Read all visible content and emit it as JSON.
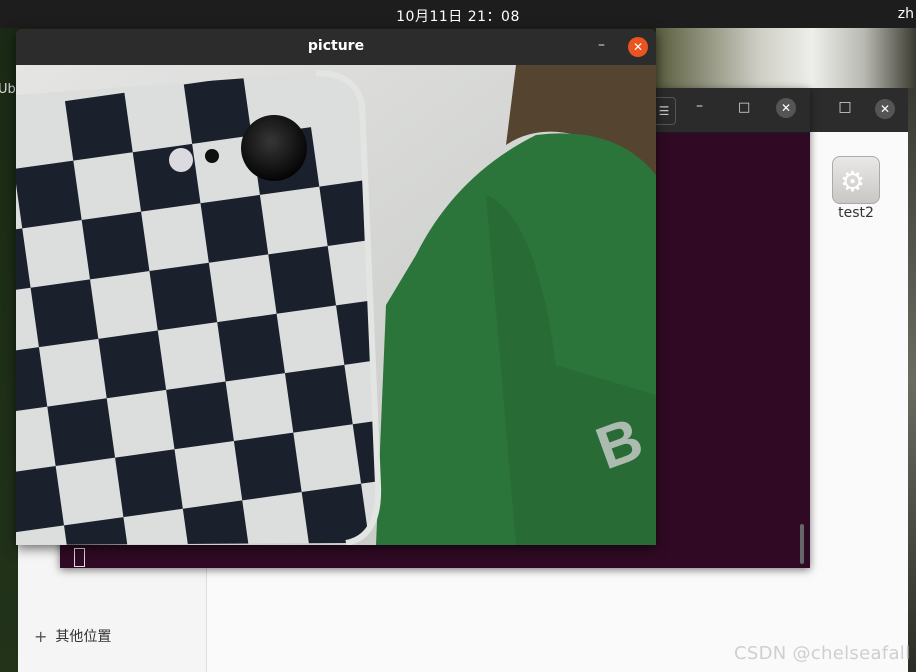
{
  "topbar": {
    "clock": "10月11日  21：08",
    "language": "zh"
  },
  "background": {
    "left_label": "Ub"
  },
  "file_manager": {
    "sidebar": {
      "other_places": "其他位置",
      "add_icon": "plus-icon"
    },
    "desktop_icon_label": "test2",
    "controls": {
      "maximize": "□",
      "close": "✕"
    }
  },
  "terminal": {
    "controls": {
      "menu": "☰",
      "minimize": "–",
      "maximize": "□",
      "close": "✕"
    },
    "background_color": "#300a24"
  },
  "picture_window": {
    "title": "picture",
    "controls": {
      "minimize": "–",
      "close": "✕"
    },
    "close_color": "#e95420"
  },
  "watermark": "CSDN @chelseafall"
}
